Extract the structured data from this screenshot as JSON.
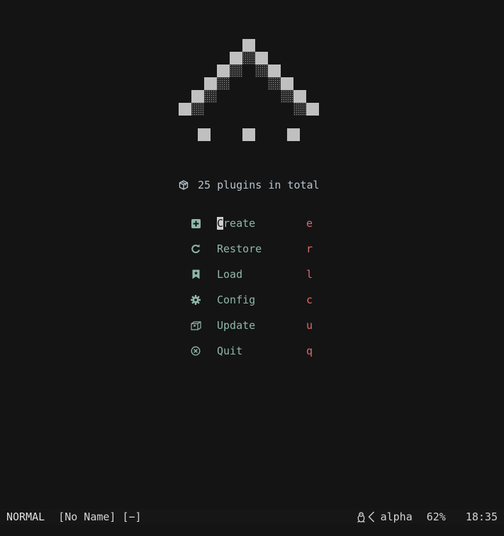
{
  "logo_name": "alpha-ascii-logo",
  "plugins": {
    "icon": "package-icon",
    "text": "25 plugins in total"
  },
  "menu": [
    {
      "icon": "plus-square-icon",
      "label": "Create",
      "key": "e"
    },
    {
      "icon": "refresh-icon",
      "label": "Restore",
      "key": "r"
    },
    {
      "icon": "bookmark-icon",
      "label": "Load",
      "key": "l"
    },
    {
      "icon": "gear-icon",
      "label": "Config",
      "key": "c"
    },
    {
      "icon": "box-icon",
      "label": "Update",
      "key": "u"
    },
    {
      "icon": "close-circle-icon",
      "label": "Quit",
      "key": "q"
    }
  ],
  "cursor_char": "C",
  "statusline": {
    "mode": "NORMAL",
    "filename": "[No Name] [−]",
    "os_icon": "linux-icon",
    "separator_icon": "chevron-left-icon",
    "filetype": "alpha",
    "progress": "62%",
    "time": "18:35"
  },
  "colors": {
    "background": "#141414",
    "menu_label": "#8fb8a8",
    "menu_key": "#e06a6a",
    "icon": "#8fb8a8"
  }
}
